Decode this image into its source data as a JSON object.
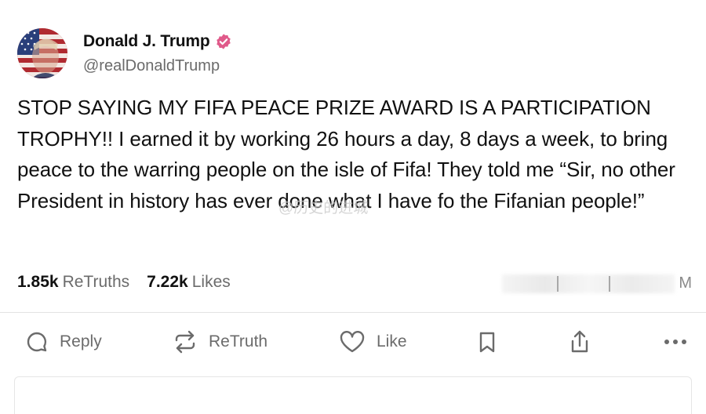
{
  "author": {
    "display_name": "Donald J. Trump",
    "handle": "@realDonaldTrump",
    "verified_color": "#e05a8a",
    "avatar_icon": "flag-portrait-avatar"
  },
  "post": {
    "text": "STOP SAYING MY FIFA PEACE PRIZE AWARD IS A PARTICIPATION TROPHY!! I earned it by working 26 hours a day, 8 days a week, to bring peace to the warring people on the isle of Fifa! They told me “Sir, no other President in history has ever done what I have fo the Fifanian people!”"
  },
  "watermark": {
    "text": "@历史的进城"
  },
  "stats": {
    "retruths_count": "1.85k",
    "retruths_label": "ReTruths",
    "likes_count": "7.22k",
    "likes_label": "Likes",
    "right_suffix": "M"
  },
  "actions": {
    "reply_label": "Reply",
    "retruth_label": "ReTruth",
    "like_label": "Like"
  },
  "colors": {
    "text": "#111111",
    "muted": "#6b6b6b",
    "divider": "#e3e3e3"
  }
}
